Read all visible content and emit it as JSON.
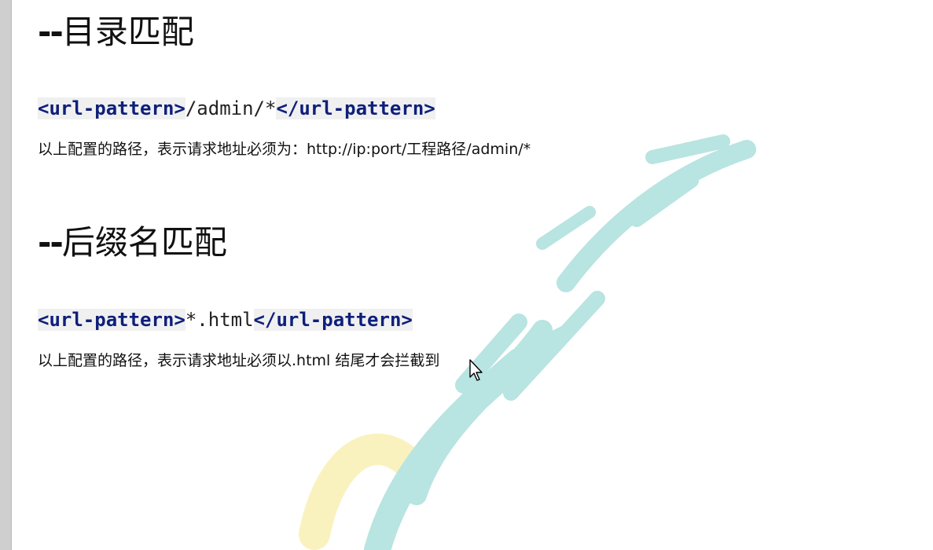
{
  "sections": [
    {
      "heading_prefix": "--",
      "heading_title": "目录匹配",
      "code_open": "<url-pattern>",
      "code_value": "/admin/*",
      "code_close": "</url-pattern>",
      "description": "以上配置的路径，表示请求地址必须为：http://ip:port/工程路径/admin/*"
    },
    {
      "heading_prefix": "--",
      "heading_title": "后缀名匹配",
      "code_open": "<url-pattern>",
      "code_value": "*.html",
      "code_close": "</url-pattern>",
      "description": "以上配置的路径，表示请求地址必须以.html 结尾才会拦截到"
    }
  ],
  "colors": {
    "tag": "#0e1f7a",
    "watermark_teal": "#7fcfc9",
    "watermark_yellow": "#f6e98a"
  },
  "icons": {
    "watermark": "school-logo-watermark",
    "cursor": "mouse-pointer-icon"
  }
}
